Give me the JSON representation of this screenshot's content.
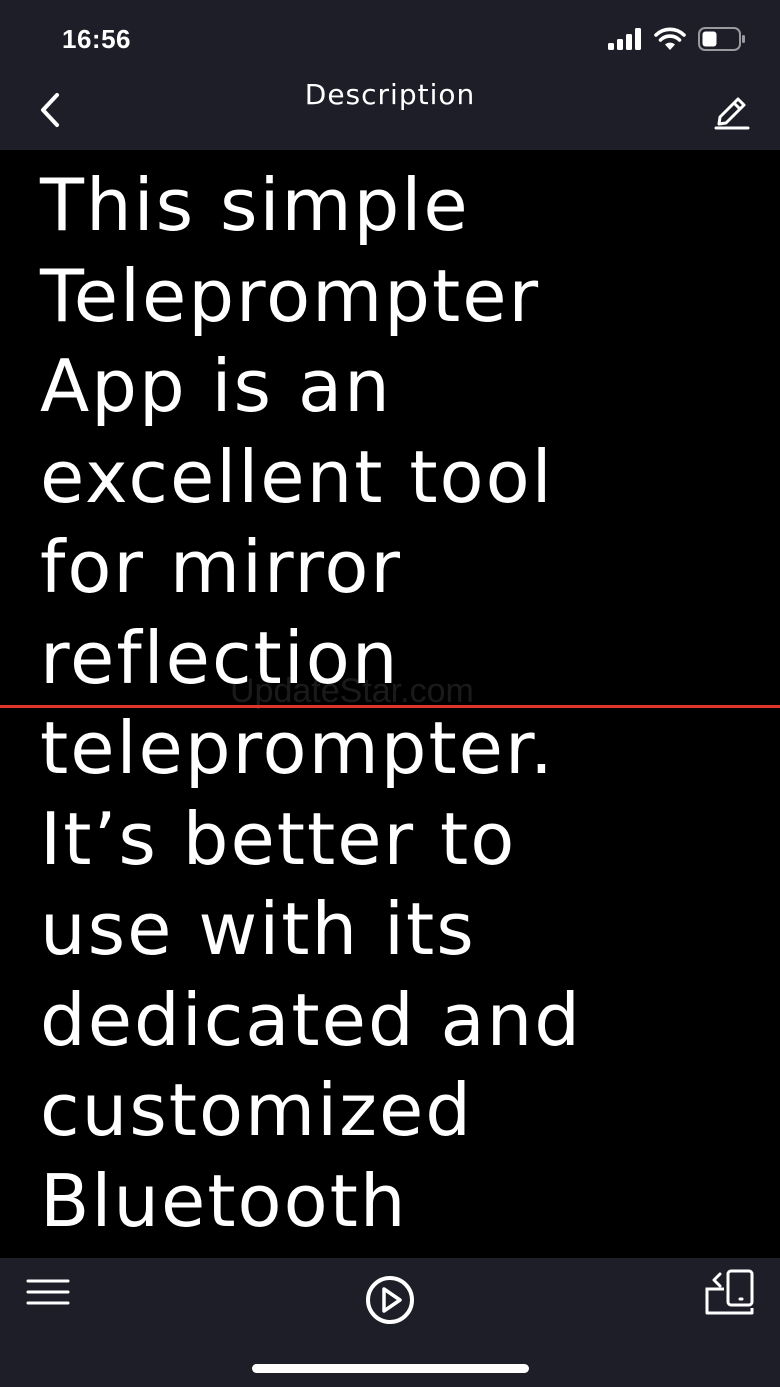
{
  "status_bar": {
    "time": "16:56",
    "icons": [
      "cellular-signal-icon",
      "wifi-icon",
      "battery-icon"
    ]
  },
  "nav": {
    "title": "Description",
    "back_icon": "chevron-left-icon",
    "edit_icon": "pencil-edit-icon"
  },
  "script": {
    "text": "This simple\nTeleprompter\nApp is an\nexcellent tool\nfor mirror\nreflection\nteleprompter.\nIt’s better to\nuse with its\ndedicated and\ncustomized\nBluetooth",
    "watermark": "UpdateStar.com"
  },
  "toolbar": {
    "menu_icon": "hamburger-menu-icon",
    "play_icon": "play-circle-icon",
    "mirror_icon": "mirror-flip-icon"
  },
  "colors": {
    "chrome_background": "#1e1e28",
    "script_background": "#000000",
    "text": "#ffffff",
    "reading_line": "#e0342b"
  }
}
